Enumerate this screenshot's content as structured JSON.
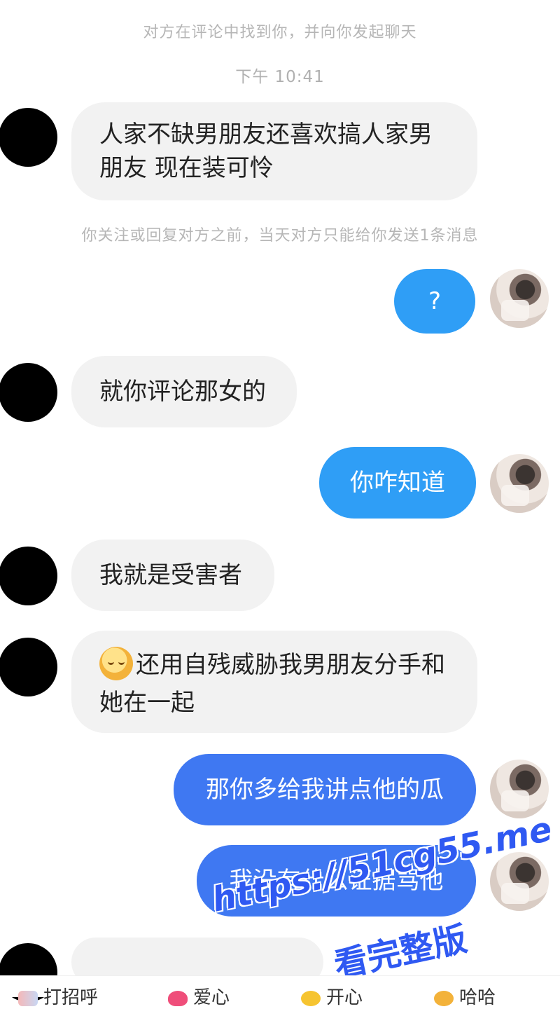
{
  "system": {
    "top_notice": "对方在评论中找到你，并向你发起聊天",
    "time": "下午 10:41",
    "limit_notice": "你关注或回复对方之前，当天对方只能给你发送1条消息"
  },
  "messages": [
    {
      "side": "left",
      "text": "人家不缺男朋友还喜欢搞人家男朋友 现在装可怜"
    },
    {
      "side": "right",
      "text": "?"
    },
    {
      "side": "left",
      "text": "就你评论那女的"
    },
    {
      "side": "right",
      "text": "你咋知道"
    },
    {
      "side": "left",
      "text": "我就是受害者"
    },
    {
      "side": "left",
      "text": "还用自残威胁我男朋友分手和她在一起"
    },
    {
      "side": "right",
      "text": "那你多给我讲点他的瓜"
    },
    {
      "side": "right",
      "text": "我没有什么证据骂他"
    }
  ],
  "watermark": {
    "url": "https://51cg55.me",
    "caption": "看完整版"
  },
  "quick_replies": [
    "打招呼",
    "爱心",
    "开心",
    "哈哈"
  ]
}
